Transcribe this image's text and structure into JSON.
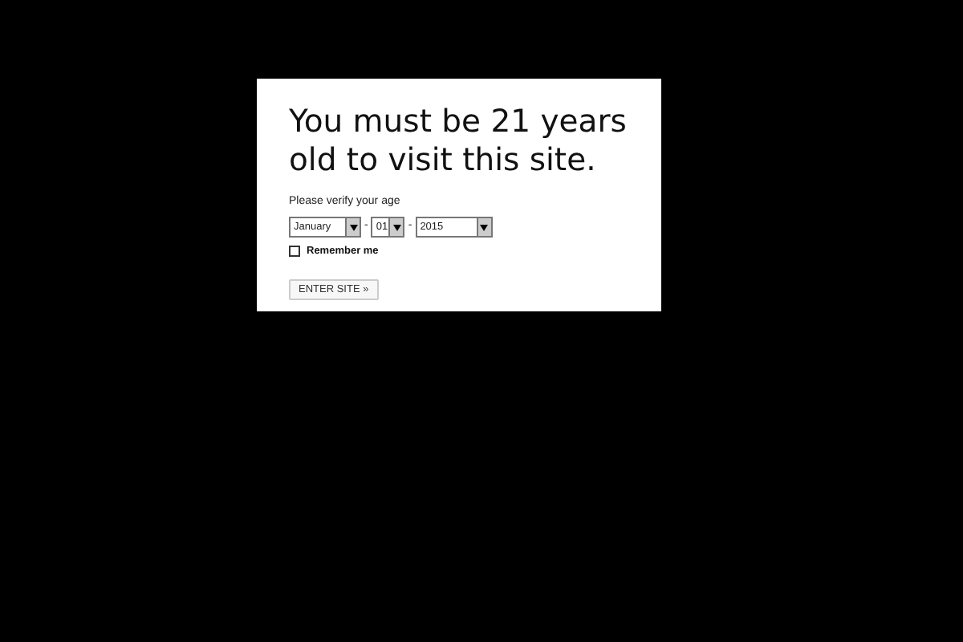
{
  "dialog": {
    "title": "You must be 21 years old to visit this site.",
    "prompt": "Please verify your age",
    "date_fields": [
      {
        "kind": "month",
        "value": "January"
      },
      {
        "kind": "day",
        "value": "01"
      },
      {
        "kind": "year",
        "value": "2015"
      }
    ],
    "separators": [
      "-",
      "-"
    ],
    "remember_me": {
      "label": "Remember me",
      "checked": false
    },
    "button": "ENTER SITE »"
  }
}
